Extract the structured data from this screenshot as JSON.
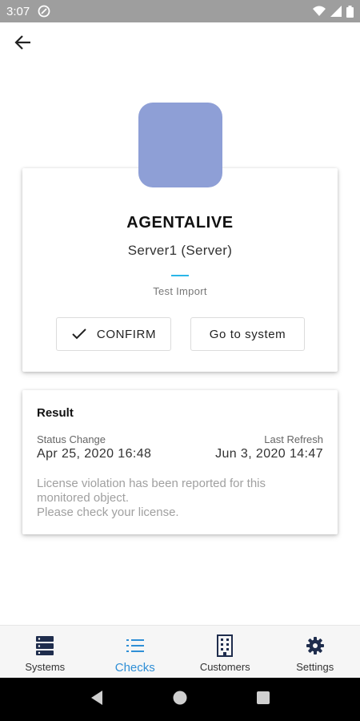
{
  "status_bar": {
    "time": "3:07",
    "icons": [
      "notification-icon",
      "wifi-icon",
      "signal-icon",
      "battery-icon"
    ]
  },
  "header": {
    "back_icon": "arrow-left-icon"
  },
  "agent_card": {
    "avatar_color": "#8e9fd6",
    "title": "AGENTALIVE",
    "subtitle": "Server1 (Server)",
    "accent_color": "#2bb6e8",
    "import_label": "Test Import",
    "confirm_label": "CONFIRM",
    "confirm_icon": "check-icon",
    "goto_label": "Go to system"
  },
  "result_card": {
    "title": "Result",
    "status_change_label": "Status Change",
    "status_change_value": "Apr 25, 2020 16:48",
    "last_refresh_label": "Last Refresh",
    "last_refresh_value": "Jun 3, 2020 14:47",
    "message_lines": [
      "License violation has been reported for this",
      "monitored object.",
      "Please check your license."
    ]
  },
  "bottom_nav": {
    "active_color": "#2f8fd6",
    "items": [
      {
        "label": "Systems",
        "icon": "server-icon",
        "active": false
      },
      {
        "label": "Checks",
        "icon": "list-icon",
        "active": true
      },
      {
        "label": "Customers",
        "icon": "building-icon",
        "active": false
      },
      {
        "label": "Settings",
        "icon": "gear-icon",
        "active": false
      }
    ]
  },
  "system_nav": {
    "icons": [
      "back-triangle-icon",
      "home-circle-icon",
      "recents-square-icon"
    ]
  }
}
